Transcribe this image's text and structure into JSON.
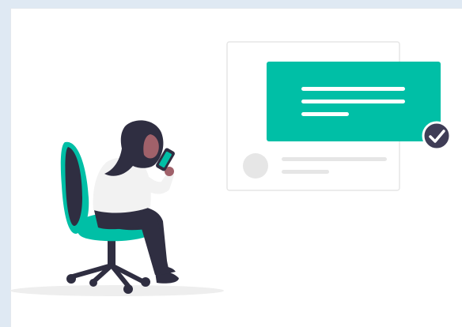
{
  "illustration": {
    "subject": "person-on-chair-with-phone",
    "colors": {
      "background": "#dfe9f3",
      "canvas": "#ffffff",
      "accent": "#00bfa6",
      "dark": "#2f2e41",
      "skin": "#a0616a",
      "shirt": "#f2f2f2",
      "card_border": "#e6e6e6",
      "placeholder": "#e6e6e6",
      "shadow": "#eeeeee"
    },
    "icons": {
      "check_badge": "check-circle-icon"
    }
  }
}
